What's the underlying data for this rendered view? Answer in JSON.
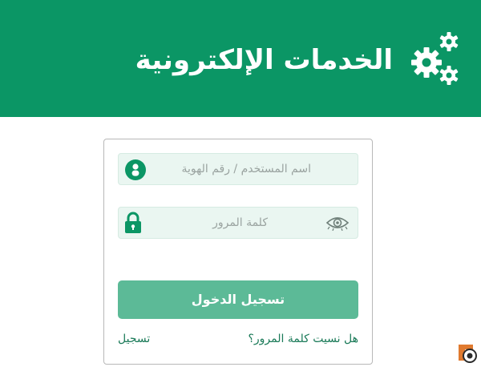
{
  "header": {
    "title": "الخدمات الإلكترونية",
    "icon": "gears-icon",
    "background": "#0b9665"
  },
  "login_form": {
    "username": {
      "placeholder": "اسم المستخدم / رقم الهوية",
      "value": "",
      "icon": "user-icon"
    },
    "password": {
      "placeholder": "كلمة المرور",
      "value": "",
      "icon": "lock-icon",
      "toggle_icon": "eye-icon"
    },
    "submit_label": "تسجيل الدخول",
    "forgot_password_label": "هل نسيت كلمة المرور؟",
    "register_label": "تسجيل",
    "accent_color": "#5cba97",
    "link_color": "#1a7a58"
  }
}
